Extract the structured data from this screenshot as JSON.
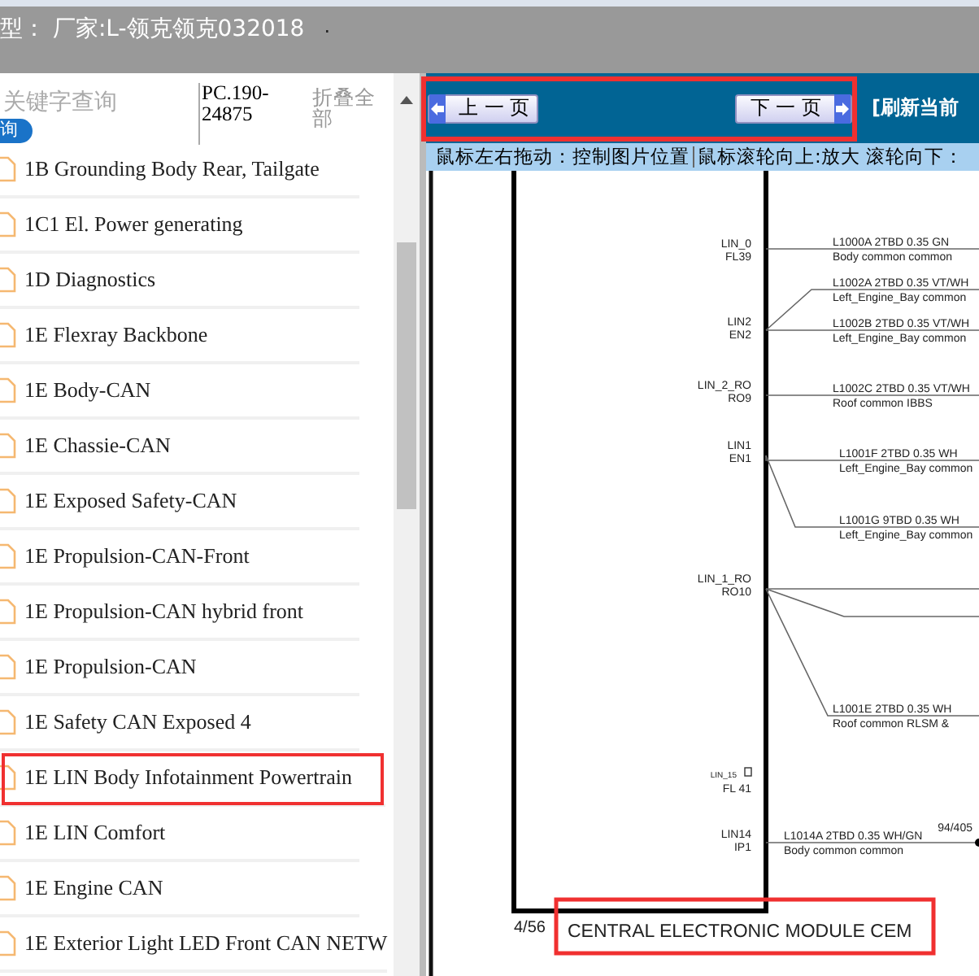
{
  "title_bar": {
    "title": "型：  厂家:L-领克领克032018",
    "dot": "."
  },
  "sidebar": {
    "search": {
      "placeholder": "关键字查询"
    },
    "search_button": "询",
    "part_number": "PC.190-24875",
    "collapse_all": "折叠全部",
    "items": [
      {
        "label": "1B Grounding Body Rear, Tailgate",
        "highlighted": false
      },
      {
        "label": "1C1 El. Power generating",
        "highlighted": false
      },
      {
        "label": "1D Diagnostics",
        "highlighted": false
      },
      {
        "label": "1E Flexray Backbone",
        "highlighted": false
      },
      {
        "label": "1E Body-CAN",
        "highlighted": false
      },
      {
        "label": "1E Chassie-CAN",
        "highlighted": false
      },
      {
        "label": "1E Exposed Safety-CAN",
        "highlighted": false
      },
      {
        "label": "1E Propulsion-CAN-Front",
        "highlighted": false
      },
      {
        "label": "1E Propulsion-CAN hybrid front",
        "highlighted": false
      },
      {
        "label": "1E Propulsion-CAN",
        "highlighted": false
      },
      {
        "label": "1E Safety CAN Exposed 4",
        "highlighted": false
      },
      {
        "label": "1E LIN Body Infotainment Powertrain",
        "highlighted": true
      },
      {
        "label": "1E LIN Comfort",
        "highlighted": false
      },
      {
        "label": "1E Engine CAN",
        "highlighted": false
      },
      {
        "label": "1E Exterior Light LED Front CAN NETW",
        "highlighted": false
      }
    ]
  },
  "viewer": {
    "nav": {
      "highlighted": true,
      "prev": "上 一 页",
      "next": "下 一 页"
    },
    "refresh": "[刷新当前",
    "hints": [
      "鼠标左右拖动：控制图片位置",
      "鼠标滚轮向上:放大  滚轮向下："
    ],
    "diagram": {
      "pins": [
        [
          "LIN_0",
          "FL39"
        ],
        [
          "LIN2",
          "EN2"
        ],
        [
          "LIN_2_RO",
          "RO9"
        ],
        [
          "LIN1",
          "EN1"
        ],
        [
          "LIN_1_RO",
          "RO10"
        ],
        [
          "LIN_15",
          "FL 41"
        ],
        [
          "LIN14",
          "IP1"
        ]
      ],
      "wires": [
        [
          "L1000A  2TBD 0.35 GN",
          "Body  common   common"
        ],
        [
          "L1002A  2TBD 0.35 VT/WH",
          "Left_Engine_Bay  common"
        ],
        [
          "L1002B  2TBD 0.35 VT/WH",
          "Left_Engine_Bay  common"
        ],
        [
          "L1002C  2TBD 0.35 VT/WH",
          "Roof  common   IBBS"
        ],
        [
          "L1001F  2TBD 0.35 WH",
          "Left_Engine_Bay  common"
        ],
        [
          "L1001G  9TBD 0.35 WH",
          "Left_Engine_Bay  common"
        ],
        [
          "L1001E  2TBD 0.35 WH",
          "Roof  common   RLSM &"
        ],
        [
          "L1014A  2TBD 0.35 WH/GN",
          "Body  common   common"
        ]
      ],
      "connector": "94/405",
      "page": "4/56",
      "caption": "CENTRAL ELECTRONIC MODULE CEM",
      "caption_highlighted": true
    }
  }
}
